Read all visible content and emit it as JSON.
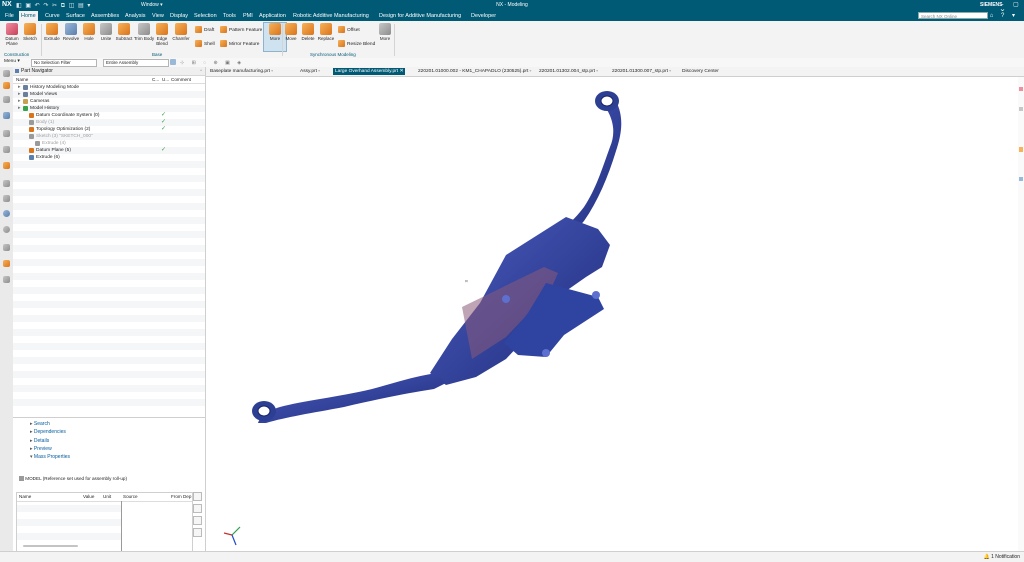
{
  "titlebar": {
    "logo": "NX",
    "quick_access_icons": "◧ ▣ ↶ ↷ ✂ ⧉ ◫ ▤ ▾",
    "window_menu": "Window ▾",
    "title": "NX - Modeling",
    "brand": "SIEMENS",
    "controls": "– ▢ ✕"
  },
  "menubar": {
    "items": [
      "File",
      "Home",
      "Curve",
      "Surface",
      "Assemblies",
      "Analysis",
      "View",
      "Display",
      "Selection",
      "Tools",
      "PMI",
      "Application",
      "Robotic Additive Manufacturing",
      "Design for Additive Manufacturing",
      "Developer"
    ],
    "active": "Home",
    "search_placeholder": "Search NX Online",
    "right_icons": "⌂ ? ▾"
  },
  "ribbon": {
    "construction": {
      "label": "Construction",
      "tools": [
        "Datum Plane",
        "Sketch"
      ]
    },
    "base": {
      "label": "Base",
      "tools": [
        "Extrude",
        "Revolve",
        "Hole",
        "Unite",
        "Subtract",
        "Trim Body",
        "Edge Blend",
        "Chamfer"
      ],
      "small_tools": [
        "Draft",
        "Shell",
        "Pattern Feature",
        "Mirror Feature"
      ],
      "more": "More"
    },
    "sync": {
      "label": "Synchronous Modeling",
      "tools": [
        "Move",
        "Delete",
        "Replace"
      ],
      "small_tools": [
        "Offset",
        "Resize Blend"
      ],
      "more": "More"
    }
  },
  "selection_bar": {
    "menu": "Menu ▾",
    "filter": "No Selection Filter",
    "scope": "Entire Assembly"
  },
  "navigator": {
    "title": "Part Navigator",
    "columns": [
      "Name",
      "C...",
      "U...",
      "Comment"
    ],
    "rows": [
      {
        "label": "History Modeling Mode",
        "indent": 1,
        "dim": false,
        "check": false,
        "color": "#6a7f9a"
      },
      {
        "label": "Model Views",
        "indent": 1,
        "dim": false,
        "check": false,
        "color": "#6a7f9a"
      },
      {
        "label": "Cameras",
        "indent": 1,
        "dim": false,
        "check": false,
        "color": "#c8a050"
      },
      {
        "label": "Model History",
        "indent": 1,
        "dim": false,
        "check": false,
        "color": "#3aa24a"
      },
      {
        "label": "Datum Coordinate System (0)",
        "indent": 2,
        "dim": false,
        "check": true,
        "color": "#d9741b"
      },
      {
        "label": "Body (1)",
        "indent": 2,
        "dim": true,
        "check": true,
        "color": "#9a9a9a"
      },
      {
        "label": "Topology Optimization (2)",
        "indent": 2,
        "dim": false,
        "check": true,
        "color": "#d9741b"
      },
      {
        "label": "Sketch (3) \"SKETCH_000\"",
        "indent": 2,
        "dim": true,
        "check": false,
        "color": "#9a9a9a"
      },
      {
        "label": "Extrude (4)",
        "indent": 3,
        "dim": true,
        "check": false,
        "color": "#9a9a9a"
      },
      {
        "label": "Datum Plane (5)",
        "indent": 2,
        "dim": false,
        "check": true,
        "color": "#d9741b"
      },
      {
        "label": "Extrude (6)",
        "indent": 2,
        "dim": false,
        "check": false,
        "color": "#5a7fae"
      }
    ],
    "panels": [
      "Search",
      "Dependencies",
      "Details",
      "Preview",
      "Mass Properties"
    ],
    "mass_properties": {
      "model_label": "MODEL (Reference set used for assembly roll-up)",
      "columns": [
        "Name",
        "Value",
        "Unit",
        "Source",
        "From Dep"
      ]
    }
  },
  "tabs": [
    {
      "label": "Baseplate manufacturing.prt",
      "active": false
    },
    {
      "label": "Assy.prt",
      "active": false
    },
    {
      "label": "Large Overhand Assembly.prt",
      "active": true
    },
    {
      "label": "220201.01000.002 - KM1_CHAPADLO (230525).prt",
      "active": false
    },
    {
      "label": "220201.01302.004_stp.prt",
      "active": false
    },
    {
      "label": "220201.01300.007_stp.prt",
      "active": false
    },
    {
      "label": "Discovery Center",
      "active": false
    }
  ],
  "statusbar": {
    "notification": "1 Notification"
  },
  "colors": {
    "brand_teal": "#005a75",
    "model_blue": "#2c3f93",
    "check_green": "#3aa24a"
  }
}
